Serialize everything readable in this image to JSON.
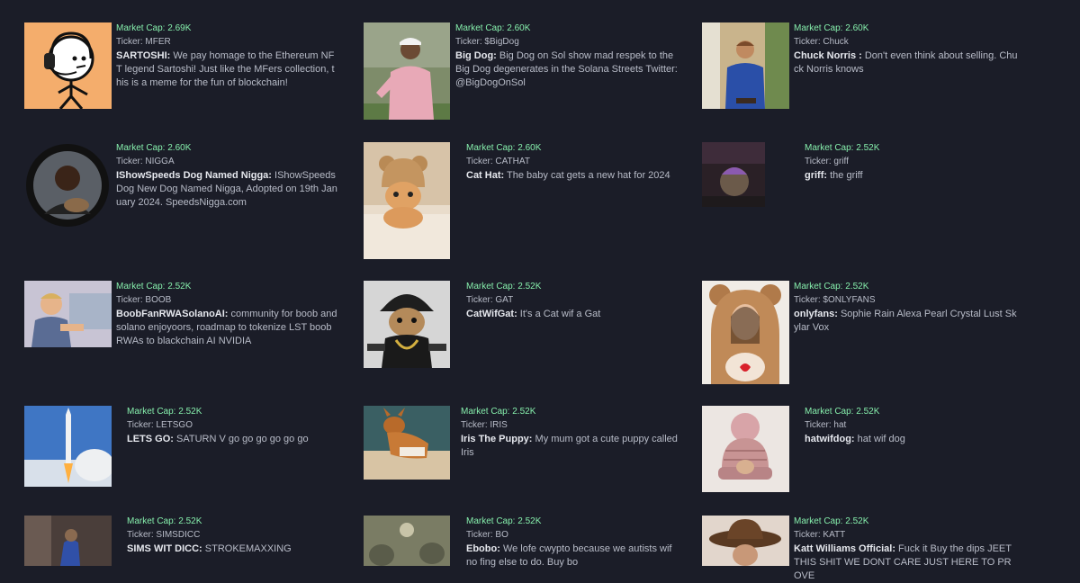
{
  "coins": [
    {
      "market_cap": "Market Cap: 2.69K",
      "ticker": "Ticker: MFER",
      "name": "SARTOSHI:",
      "description": "We pay homage to the Ethereum NFT legend Sartoshi! Just like the MFers collection, this is a meme for the fun of blockchain!",
      "image": "stick-figure-headphones"
    },
    {
      "market_cap": "Market Cap: 2.60K",
      "ticker": "Ticker: $BigDog",
      "name": "Big Dog:",
      "description": "Big Dog on Sol show mad respek to the Big Dog degenerates in the Solana Streets Twitter: @BigDogOnSol",
      "image": "golfer-photo"
    },
    {
      "market_cap": "Market Cap: 2.60K",
      "ticker": "Ticker: Chuck",
      "name": "Chuck Norris :",
      "description": "Don't even think about selling. Chuck Norris knows",
      "image": "cowboy-photo"
    },
    {
      "market_cap": "Market Cap: 2.60K",
      "ticker": "Ticker: NIGGA",
      "name": "IShowSpeeds Dog Named Nigga:",
      "description": "IShowSpeeds Dog New Dog Named Nigga, Adopted on 19th January 2024. SpeedsNigga.com",
      "image": "round-portrait"
    },
    {
      "market_cap": "Market Cap: 2.60K",
      "ticker": "Ticker: CATHAT",
      "name": "Cat Hat:",
      "description": "The baby cat gets a new hat for 2024",
      "image": "cat-in-bear-hat"
    },
    {
      "market_cap": "Market Cap: 2.52K",
      "ticker": "Ticker: griff",
      "name": "griff:",
      "description": "the griff",
      "image": "dark-webcam"
    },
    {
      "market_cap": "Market Cap: 2.52K",
      "ticker": "Ticker: BOOB",
      "name": "BoobFanRWASolanoAI:",
      "description": "community for boob and solano enjoyoors, roadmap to tokenize LST boob RWAs to blackchain AI NVIDIA",
      "image": "kid-at-computer"
    },
    {
      "market_cap": "Market Cap: 2.52K",
      "ticker": "Ticker: GAT",
      "name": "CatWifGat:",
      "description": "It's a Cat wif a Gat",
      "image": "gangster-cat"
    },
    {
      "market_cap": "Market Cap: 2.52K",
      "ticker": "Ticker: $ONLYFANS",
      "name": "onlyfans:",
      "description": "Sophie Rain Alexa Pearl Crystal Lust Skylar Vox",
      "image": "bear-costume-portrait"
    },
    {
      "market_cap": "Market Cap: 2.52K",
      "ticker": "Ticker: LETSGO",
      "name": "LETS GO:",
      "description": "SATURN V go go go go go go",
      "image": "rocket-launch"
    },
    {
      "market_cap": "Market Cap: 2.52K",
      "ticker": "Ticker: IRIS",
      "name": "Iris The Puppy:",
      "description": "My mum got a cute puppy called Iris",
      "image": "puppy-on-blanket"
    },
    {
      "market_cap": "Market Cap: 2.52K",
      "ticker": "Ticker: hat",
      "name": "hatwifdog:",
      "description": "hat wif dog",
      "image": "knit-pompom-hat"
    },
    {
      "market_cap": "Market Cap: 2.52K",
      "ticker": "Ticker: SIMSDICC",
      "name": "SIMS WIT DICC:",
      "description": "STROKEMAXXING",
      "image": "sims-scene"
    },
    {
      "market_cap": "Market Cap: 2.52K",
      "ticker": "Ticker: BO",
      "name": "Ebobo:",
      "description": "We lofe cwypto because we autists wif no fing else to do. Buy bo",
      "image": "gray-creature-art"
    },
    {
      "market_cap": "Market Cap: 2.52K",
      "ticker": "Ticker: KATT",
      "name": "Katt Williams Official:",
      "description": "Fuck it Buy the dips JEET THIS SHIT WE DONT CARE JUST HERE TO PROVE",
      "image": "brown-hat-portrait"
    }
  ],
  "colors": {
    "background": "#1b1d28",
    "market_cap": "#86efac",
    "text": "#b8bcc8",
    "name": "#e6e8ee"
  }
}
